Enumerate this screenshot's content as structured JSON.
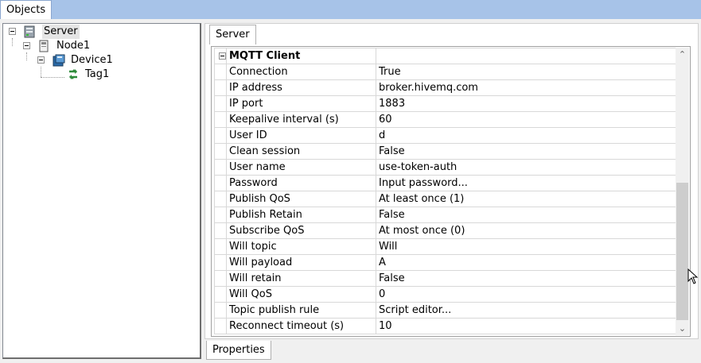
{
  "tabs": {
    "objects": "Objects",
    "server": "Server",
    "properties": "Properties"
  },
  "tree": [
    {
      "label": "Server",
      "icon": "server-icon"
    },
    {
      "label": "Node1",
      "icon": "node-icon"
    },
    {
      "label": "Device1",
      "icon": "device-icon"
    },
    {
      "label": "Tag1",
      "icon": "tag-icon"
    }
  ],
  "grid": {
    "category": "MQTT Client",
    "rows": [
      {
        "name": "Connection",
        "value": "True"
      },
      {
        "name": "IP address",
        "value": "broker.hivemq.com"
      },
      {
        "name": "IP port",
        "value": "1883"
      },
      {
        "name": "Keepalive interval (s)",
        "value": "60"
      },
      {
        "name": "User ID",
        "value": "d"
      },
      {
        "name": "Clean session",
        "value": "False"
      },
      {
        "name": "User name",
        "value": "use-token-auth"
      },
      {
        "name": "Password",
        "value": "Input password..."
      },
      {
        "name": "Publish QoS",
        "value": "At least once (1)"
      },
      {
        "name": "Publish Retain",
        "value": "False"
      },
      {
        "name": "Subscribe QoS",
        "value": "At most once (0)"
      },
      {
        "name": "Will topic",
        "value": "Will"
      },
      {
        "name": "Will payload",
        "value": "A"
      },
      {
        "name": "Will retain",
        "value": "False"
      },
      {
        "name": "Will QoS",
        "value": "0"
      },
      {
        "name": "Topic publish rule",
        "value": "Script editor..."
      },
      {
        "name": "Reconnect timeout (s)",
        "value": "10"
      }
    ]
  },
  "colors": {
    "header_bar": "#a7c3e8",
    "tag_icon": "#2e8b3a",
    "device_icon": "#2a6aa8"
  }
}
